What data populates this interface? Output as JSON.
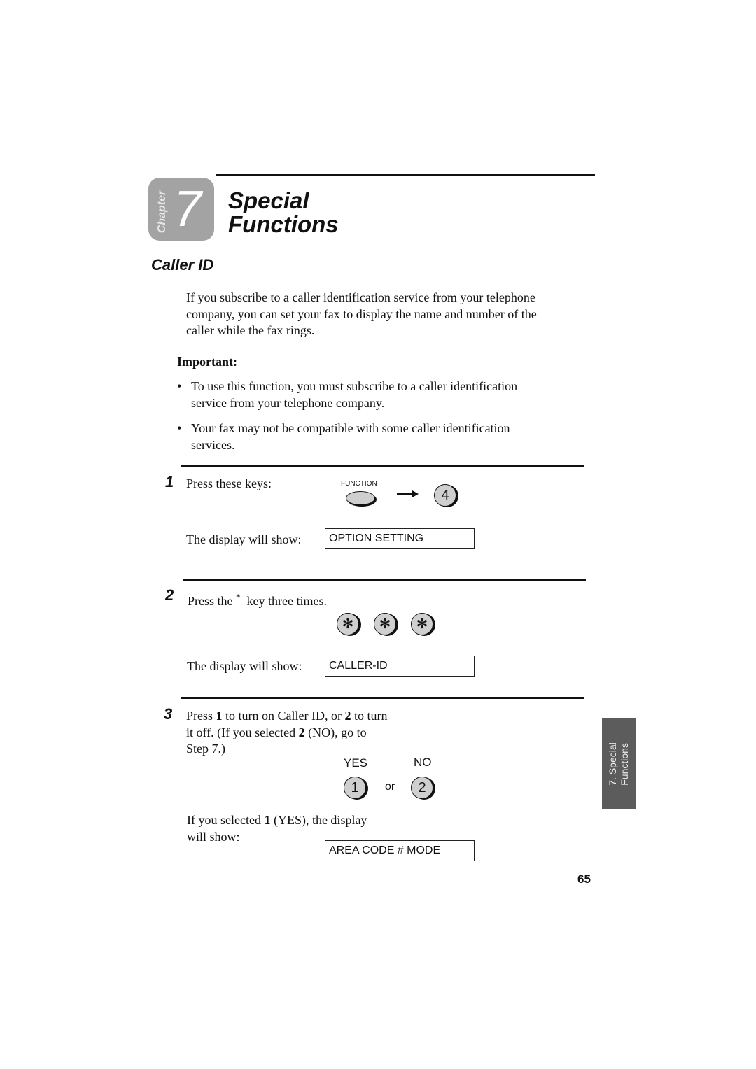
{
  "chapter": {
    "label": "Chapter",
    "number": "7",
    "title_line1": "Special",
    "title_line2": "Functions"
  },
  "section": {
    "title": "Caller ID",
    "intro_lines": [
      "If you subscribe to a caller identification service from your telephone",
      "company, you can set your fax to display the name and number of the",
      "caller while the fax rings."
    ],
    "important_label": "Important:",
    "bullets": [
      [
        "To use this function, you must subscribe to a caller identification",
        "service from your telephone company."
      ],
      [
        "Your fax may not be compatible with some caller identification",
        "services."
      ]
    ]
  },
  "steps": [
    {
      "number": "1",
      "text": "Press these keys:",
      "function_key_label": "FUNCTION",
      "key": "4",
      "display_prefix": "The display will show:",
      "display": "OPTION SETTING"
    },
    {
      "number": "2",
      "text_before": "Press the",
      "star": "*",
      "text_after": "key three times.",
      "keys": [
        "✻",
        "✻",
        "✻"
      ],
      "display_prefix": "The display will show:",
      "display": "CALLER-ID"
    },
    {
      "number": "3",
      "line1_a": "Press ",
      "line1_b": "1",
      "line1_c": " to turn on Caller ID, or ",
      "line1_d": "2",
      "line1_e": " to turn",
      "line2_a": "it off. (If you selected ",
      "line2_b": "2",
      "line2_c": " (NO), go to",
      "line3": "Step 7.)",
      "yes_label": "YES",
      "no_label": "NO",
      "yes_key": "1",
      "or_label": "or",
      "no_key": "2",
      "follow_a": "If you selected ",
      "follow_b": "1",
      "follow_c": " (YES), the display",
      "follow_line2": "will show:",
      "display": "AREA CODE # MODE"
    }
  ],
  "side_tab": {
    "line1": "7. Special",
    "line2": "Functions"
  },
  "page_number": "65"
}
